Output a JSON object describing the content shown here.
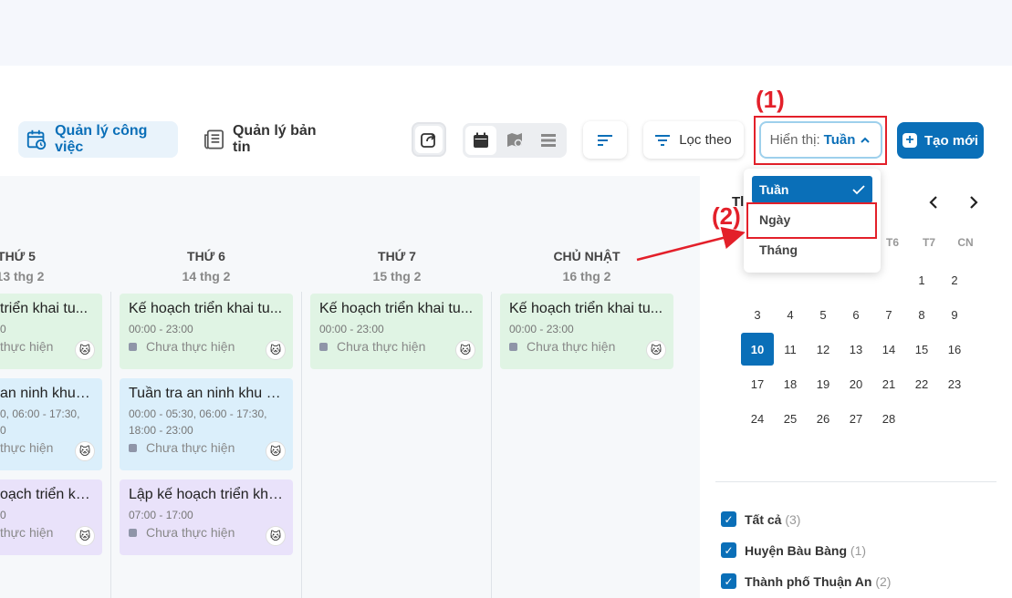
{
  "toolbar": {
    "tab_tasks": "Quản lý công việc",
    "tab_news": "Quản lý bản tin",
    "filter_label": "Lọc theo",
    "display_prefix": "Hiển thị: ",
    "display_value": "Tuần",
    "new_label": "Tạo mới",
    "accent_color": "#0a6fb8"
  },
  "callouts": {
    "one": "(1)",
    "two": "(2)"
  },
  "dropdown": {
    "items": [
      "Tuần",
      "Ngày",
      "Tháng"
    ],
    "selected": "Tuần"
  },
  "week": {
    "days": [
      {
        "name": "THỨ 5",
        "date": "13 thg 2"
      },
      {
        "name": "THỨ 6",
        "date": "14 thg 2"
      },
      {
        "name": "THỨ 7",
        "date": "15 thg 2"
      },
      {
        "name": "CHỦ NHẬT",
        "date": "16 thg 2"
      }
    ],
    "col0": [
      {
        "title": "triển khai tu...",
        "time": "0",
        "status": "thực hiện"
      },
      {
        "title": "an ninh khu v...",
        "time": "0, 06:00 - 17:30,",
        "time2": "0",
        "status": "thực hiện"
      },
      {
        "title": "oạch triển kha...",
        "time": "0",
        "status": "thực hiện"
      }
    ],
    "col1": [
      {
        "title": "Kế hoạch triển khai tu...",
        "time": "00:00 - 23:00",
        "status": "Chưa thực hiện"
      },
      {
        "title": "Tuần tra an ninh khu v...",
        "time": "00:00 - 05:30, 06:00 - 17:30,",
        "time2": "18:00 - 23:00",
        "status": "Chưa thực hiện"
      },
      {
        "title": "Lập kế hoạch triển kha...",
        "time": "07:00 - 17:00",
        "status": "Chưa thực hiện"
      }
    ],
    "col2": [
      {
        "title": "Kế hoạch triển khai tu...",
        "time": "00:00 - 23:00",
        "status": "Chưa thực hiện"
      }
    ],
    "col3": [
      {
        "title": "Kế hoạch triển khai tu...",
        "time": "00:00 - 23:00",
        "status": "Chưa thực hiện"
      }
    ]
  },
  "mini_calendar": {
    "header_partial": "Tl",
    "weekdays": [
      "T6",
      "T7",
      "CN"
    ],
    "today": "10",
    "rows": [
      [
        "",
        "",
        "",
        "",
        "",
        "1",
        "2"
      ],
      [
        "3",
        "4",
        "5",
        "6",
        "7",
        "8",
        "9"
      ],
      [
        "10",
        "11",
        "12",
        "13",
        "14",
        "15",
        "16"
      ],
      [
        "17",
        "18",
        "19",
        "20",
        "21",
        "22",
        "23"
      ],
      [
        "24",
        "25",
        "26",
        "27",
        "28",
        "",
        ""
      ]
    ]
  },
  "filters": [
    {
      "label": "Tất cả",
      "count": "(3)"
    },
    {
      "label": "Huyện Bàu Bàng",
      "count": "(1)"
    },
    {
      "label": "Thành phố Thuận An",
      "count": "(2)"
    }
  ]
}
